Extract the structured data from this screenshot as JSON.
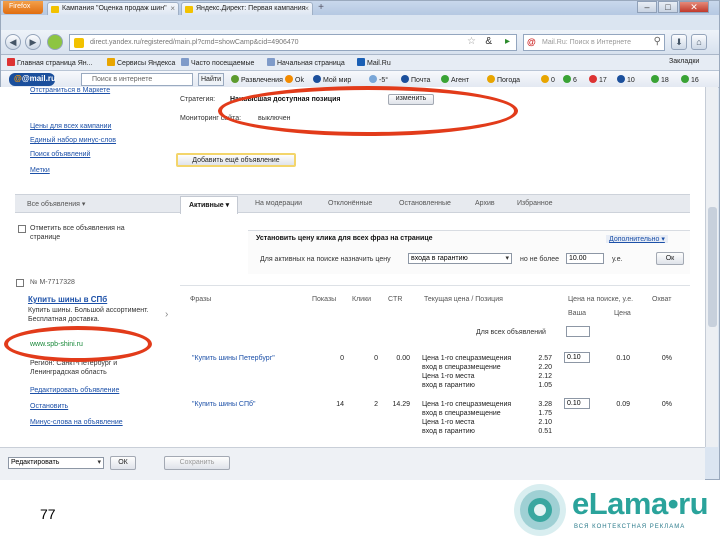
{
  "browser": {
    "app_button": "Firefox",
    "tabs": [
      {
        "label": "Кампания \"Оценка продаж шин\""
      },
      {
        "label": "Яндекс.Директ: Первая кампания"
      }
    ],
    "url": "direct.yandex.ru/registered/main.pl?cmd=showCamp&cid=4906470",
    "search_placeholder": "Mail.Ru: Поиск в Интернете",
    "bookmarks": [
      "Главная страница Ян...",
      "Сервисы Яндекса",
      "Часто посещаемые",
      "Начальная страница",
      "Mail.Ru"
    ],
    "bookmarks_right": "Закладки"
  },
  "mailru_toolbar": {
    "logo": "@mail.ru",
    "search_placeholder": "Поиск в интернете",
    "find_button": "Найти",
    "items": [
      "Развлечения",
      "Ok",
      "Мой мир",
      "-5°",
      "Почта",
      "Агент"
    ],
    "right_items": [
      "Погода",
      "0",
      "6",
      "17",
      "10",
      "18",
      "16"
    ]
  },
  "sidebar": {
    "links": [
      "Отстраниться в Маркете",
      "Цены для всех кампании",
      "Единый набор минус-слов",
      "Поиск объявлений",
      "Метки"
    ],
    "all_ads": "Все объявления"
  },
  "strategy": {
    "label": "Стратегия:",
    "value": "Наивысшая доступная позиция",
    "change_button": "изменить",
    "monitoring_label": "Мониторинг сайта:",
    "monitoring_value": "выключен",
    "add_ad_button": "Добавить ещё объявление"
  },
  "status_tabs": [
    "Активные",
    "На модерации",
    "Отклонённые",
    "Остановленные",
    "Архив",
    "Избранное"
  ],
  "select_all": "Отметить все объявления на странице",
  "bulk": {
    "title": "Установить цену клика для всех фраз на странице",
    "advanced": "Дополнительно",
    "label": "Для активных на поиске назначить цену",
    "select_value": "входа в гарантию",
    "not_more": "но не более",
    "max_value": "10.00",
    "currency": "у.е.",
    "ok_button": "Ок"
  },
  "table": {
    "headers": [
      "Фразы",
      "Показы",
      "Клики",
      "CTR",
      "Текущая цена / Позиция",
      "Цена на поиске, у.е.",
      "Охват"
    ],
    "sub_header": "Для всех объявлений",
    "sub_header_2": "Ваша",
    "sub_header_3": "Цена",
    "rows": [
      {
        "phrase": "\"Купить шины Петербург\"",
        "shows": "0",
        "clicks": "0",
        "ctr": "0.00",
        "positions": [
          "Цена 1-го спецразмещения",
          "вход в спецразмещение",
          "Цена 1-го места",
          "вход в гарантию"
        ],
        "prices": [
          "2.57",
          "2.20",
          "2.12",
          "1.05"
        ],
        "my_price": "0.10",
        "price": "0.10",
        "coverage": "0%"
      },
      {
        "phrase": "\"Купить шины СПб\"",
        "shows": "14",
        "clicks": "2",
        "ctr": "14.29",
        "positions": [
          "Цена 1-го спецразмещения",
          "вход в спецразмещение",
          "Цена 1-го места",
          "вход в гарантию"
        ],
        "prices": [
          "3.28",
          "1.75",
          "2.10",
          "0.51"
        ],
        "my_price": "0.10",
        "price": "0.09",
        "coverage": "0%"
      }
    ]
  },
  "ad_card": {
    "number": "№ М-7717328",
    "title": "Купить шины в СПб",
    "text": "Купить шины. Большой ассортимент. Бесплатная доставка.",
    "url": "www.spb-shini.ru",
    "region": "Регион: Санкт-Петербург и Ленинградская область",
    "actions": [
      "Редактировать объявление",
      "Остановить",
      "Минус-слова на объявление"
    ]
  },
  "footer": {
    "action_select": "Редактировать",
    "ok_button": "ОК",
    "save_button": "Сохранить"
  },
  "slide": {
    "number": "77",
    "logo_text": "eLama•ru",
    "logo_subtitle": "ВСЯ КОНТЕКСТНАЯ РЕКЛАМА"
  }
}
